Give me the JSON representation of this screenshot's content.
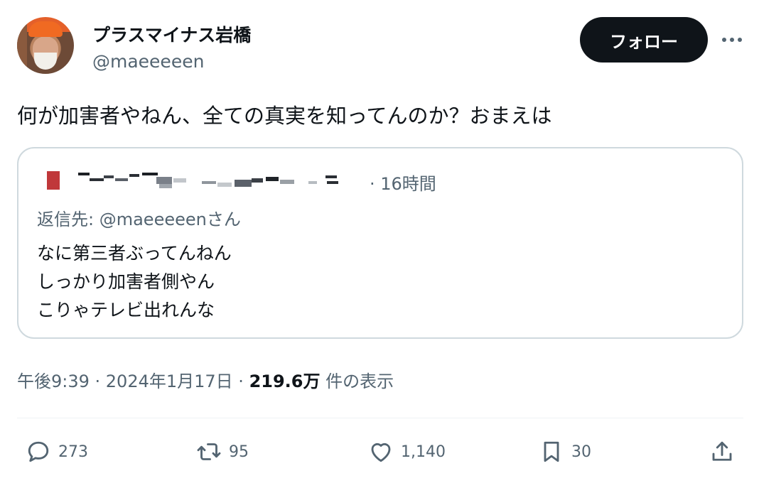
{
  "author": {
    "display_name": "プラスマイナス岩橋",
    "handle": "@maeeeeen",
    "avatar_icon": "profile-photo"
  },
  "header": {
    "follow_label": "フォロー",
    "more_icon": "ellipsis-icon"
  },
  "tweet": {
    "text": "何が加害者やねん、全ての真実を知ってんのか？おまえは"
  },
  "quoted_tweet": {
    "time_text": "· 16時間",
    "reply_to": "返信先: @maeeeeenさん",
    "lines": [
      "なに第三者ぶってんねん",
      "しっかり加害者側やん",
      "こりゃテレビ出れんな"
    ]
  },
  "meta": {
    "time": "午後9:39 · 2024年1月17日 · ",
    "views": "219.6万",
    "views_suffix": " 件の表示"
  },
  "actions": {
    "reply_count": "273",
    "retweet_count": "95",
    "like_count": "1,140",
    "bookmark_count": "30"
  },
  "colors": {
    "text": "#0f1419",
    "secondary": "#536471",
    "border": "#cfd9de",
    "button_bg": "#0f1419"
  }
}
